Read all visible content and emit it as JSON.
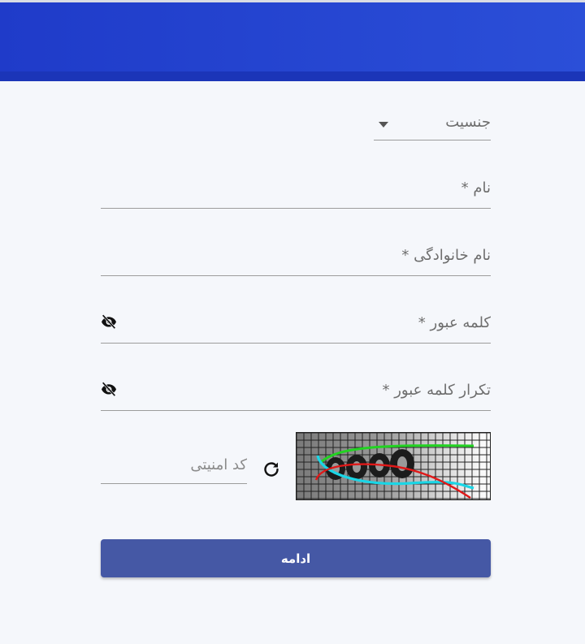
{
  "form": {
    "gender": {
      "label": "جنسیت"
    },
    "first_name": {
      "label": "نام *"
    },
    "last_name": {
      "label": "نام خانوادگی *"
    },
    "password": {
      "label": "کلمه عبور *"
    },
    "password_repeat": {
      "label": "تکرار کلمه عبور *"
    },
    "captcha": {
      "label": "کد امنیتی"
    },
    "submit_label": "ادامه"
  },
  "colors": {
    "header": "#2544d1",
    "button": "#4558a5",
    "background": "#f5f7fb"
  },
  "icons": {
    "password_toggle": "eye-off-icon",
    "captcha_refresh": "refresh-icon",
    "gender_dropdown": "caret-down-icon"
  }
}
